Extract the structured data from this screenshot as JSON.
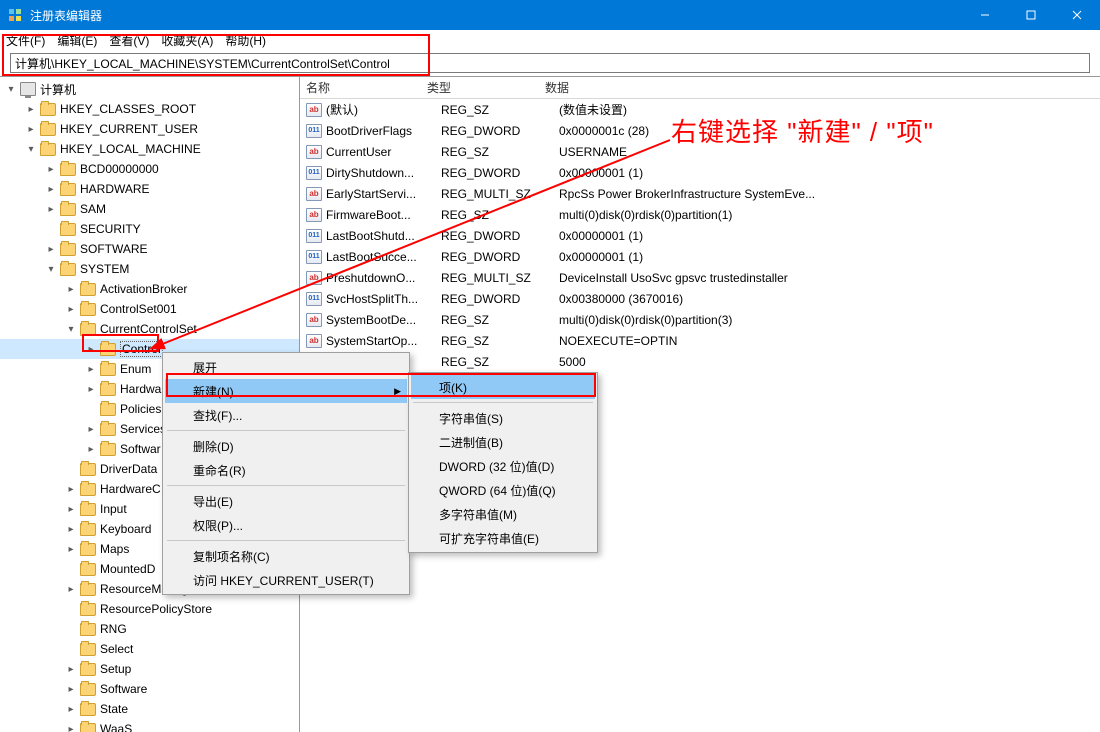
{
  "window": {
    "title": "注册表编辑器"
  },
  "menu": {
    "file": "文件(F)",
    "edit": "编辑(E)",
    "view": "查看(V)",
    "fav": "收藏夹(A)",
    "help": "帮助(H)"
  },
  "address": "计算机\\HKEY_LOCAL_MACHINE\\SYSTEM\\CurrentControlSet\\Control",
  "cols": {
    "name": "名称",
    "type": "类型",
    "data": "数据"
  },
  "tree": {
    "root": "计算机",
    "hkcr": "HKEY_CLASSES_ROOT",
    "hkcu": "HKEY_CURRENT_USER",
    "hklm": "HKEY_LOCAL_MACHINE",
    "bcd": "BCD00000000",
    "hardware": "HARDWARE",
    "sam": "SAM",
    "security": "SECURITY",
    "software": "SOFTWARE",
    "system": "SYSTEM",
    "activation": "ActivationBroker",
    "cs001": "ControlSet001",
    "ccs": "CurrentControlSet",
    "control": "Control",
    "enum": "Enum",
    "hwp": "Hardwa",
    "policies": "Policies",
    "services": "Services",
    "softwarep": "Softwar",
    "driverdb": "DriverData",
    "hwcfg": "HardwareC",
    "input": "Input",
    "keyboard": "Keyboard",
    "maps": "Maps",
    "mounted": "MountedD",
    "resmgr": "ResourceManager",
    "respol": "ResourcePolicyStore",
    "rng": "RNG",
    "select": "Select",
    "setup": "Setup",
    "software2": "Software",
    "state": "State",
    "waas": "WaaS"
  },
  "values": [
    {
      "i": "sz",
      "n": "(默认)",
      "t": "REG_SZ",
      "d": "(数值未设置)"
    },
    {
      "i": "bin",
      "n": "BootDriverFlags",
      "t": "REG_DWORD",
      "d": "0x0000001c (28)"
    },
    {
      "i": "sz",
      "n": "CurrentUser",
      "t": "REG_SZ",
      "d": "USERNAME"
    },
    {
      "i": "bin",
      "n": "DirtyShutdown...",
      "t": "REG_DWORD",
      "d": "0x00000001 (1)"
    },
    {
      "i": "sz",
      "n": "EarlyStartServi...",
      "t": "REG_MULTI_SZ",
      "d": "RpcSs Power BrokerInfrastructure SystemEve..."
    },
    {
      "i": "sz",
      "n": "FirmwareBoot...",
      "t": "REG_SZ",
      "d": "multi(0)disk(0)rdisk(0)partition(1)"
    },
    {
      "i": "bin",
      "n": "LastBootShutd...",
      "t": "REG_DWORD",
      "d": "0x00000001 (1)"
    },
    {
      "i": "bin",
      "n": "LastBootSucce...",
      "t": "REG_DWORD",
      "d": "0x00000001 (1)"
    },
    {
      "i": "sz",
      "n": "PreshutdownO...",
      "t": "REG_MULTI_SZ",
      "d": "DeviceInstall UsoSvc gpsvc trustedinstaller"
    },
    {
      "i": "bin",
      "n": "SvcHostSplitTh...",
      "t": "REG_DWORD",
      "d": "0x00380000 (3670016)"
    },
    {
      "i": "sz",
      "n": "SystemBootDe...",
      "t": "REG_SZ",
      "d": "multi(0)disk(0)rdisk(0)partition(3)"
    },
    {
      "i": "sz",
      "n": "SystemStartOp...",
      "t": "REG_SZ",
      "d": "  NOEXECUTE=OPTIN"
    },
    {
      "i": "sz",
      "n": "",
      "t": "REG_SZ",
      "d": "5000"
    }
  ],
  "ctx": {
    "expand": "展开",
    "new": "新建(N)",
    "find": "查找(F)...",
    "delete": "删除(D)",
    "rename": "重命名(R)",
    "export": "导出(E)",
    "perm": "权限(P)...",
    "copykey": "复制项名称(C)",
    "goto": "访问 HKEY_CURRENT_USER(T)"
  },
  "sub": {
    "key": "项(K)",
    "string": "字符串值(S)",
    "binary": "二进制值(B)",
    "dword": "DWORD (32 位)值(D)",
    "qword": "QWORD (64 位)值(Q)",
    "multi": "多字符串值(M)",
    "expand": "可扩充字符串值(E)"
  },
  "annot": "右键选择 \"新建\" / \"项\""
}
